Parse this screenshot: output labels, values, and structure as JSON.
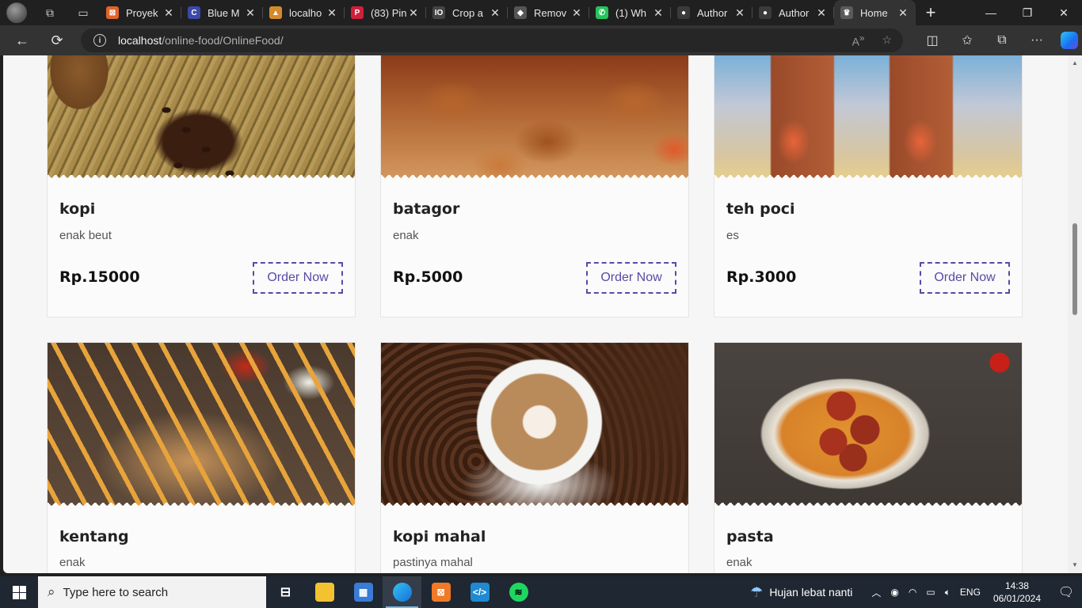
{
  "browser": {
    "tabs": [
      {
        "title": "Proyek",
        "fav_color": "#e0642a",
        "fav_char": "⊠"
      },
      {
        "title": "Blue M",
        "fav_color": "#3b4aa8",
        "fav_char": "C"
      },
      {
        "title": "localho",
        "fav_color": "#d58a2a",
        "fav_char": "▲"
      },
      {
        "title": "(83) Pin",
        "fav_color": "#d0203a",
        "fav_char": "P"
      },
      {
        "title": "Crop a",
        "fav_color": "#444444",
        "fav_char": "IO"
      },
      {
        "title": "Remov",
        "fav_color": "#555555",
        "fav_char": "◆"
      },
      {
        "title": "(1) Wh",
        "fav_color": "#25c35a",
        "fav_char": "✆"
      },
      {
        "title": "Author",
        "fav_color": "#3a3a3a",
        "fav_char": "●"
      },
      {
        "title": "Author",
        "fav_color": "#3a3a3a",
        "fav_char": "●"
      },
      {
        "title": "Home",
        "fav_color": "#5a5a5a",
        "fav_char": "♛"
      }
    ],
    "url_host": "localhost",
    "url_path": "/online-food/OnlineFood/"
  },
  "menu": {
    "order_label": "Order Now",
    "items": [
      {
        "name": "kopi",
        "desc": "enak beut",
        "price": "Rp.15000",
        "image": "coffee-beans"
      },
      {
        "name": "batagor",
        "desc": "enak",
        "price": "Rp.5000",
        "image": "batagor"
      },
      {
        "name": "teh poci",
        "desc": "es",
        "price": "Rp.3000",
        "image": "iced-tea"
      },
      {
        "name": "kentang",
        "desc": "enak",
        "image": "french-fries"
      },
      {
        "name": "kopi mahal",
        "desc": "pastinya mahal",
        "image": "latte"
      },
      {
        "name": "pasta",
        "desc": "enak",
        "image": "spaghetti-meatballs"
      }
    ]
  },
  "taskbar": {
    "search_placeholder": "Type here to search",
    "weather": "Hujan lebat nanti",
    "lang": "ENG",
    "time": "14:38",
    "date": "06/01/2024"
  }
}
